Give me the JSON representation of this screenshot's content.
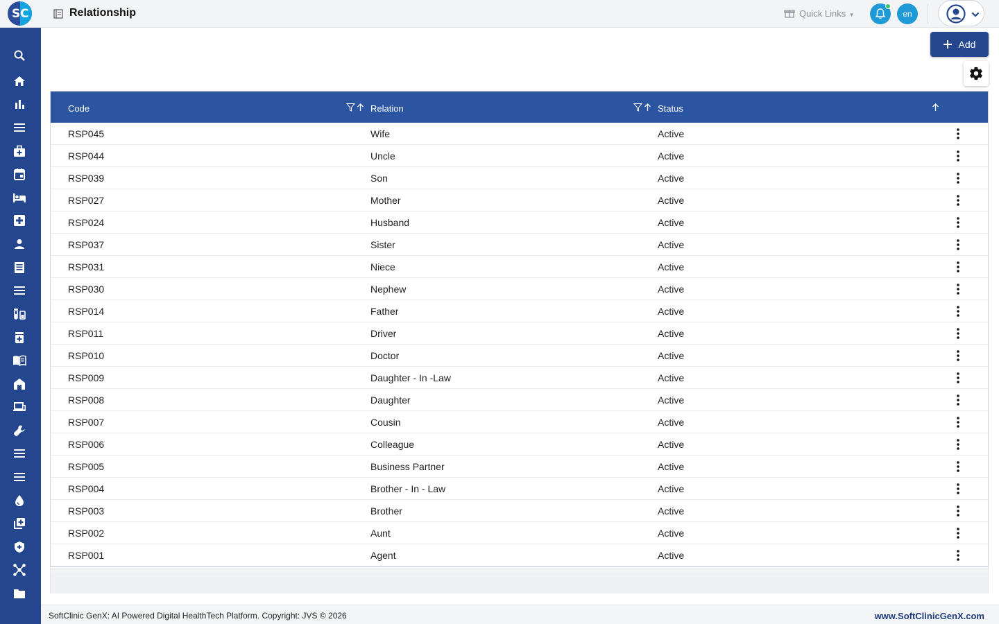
{
  "header": {
    "logo": "SC",
    "page_title": "Relationship",
    "quick_links_label": "Quick Links",
    "language": "en"
  },
  "sidebar": {
    "items": [
      {
        "icon": "search-icon"
      },
      {
        "icon": "home-icon"
      },
      {
        "icon": "bar-chart-icon"
      },
      {
        "icon": "menu-icon"
      },
      {
        "icon": "medical-bag-icon"
      },
      {
        "icon": "calendar-icon"
      },
      {
        "icon": "bed-icon"
      },
      {
        "icon": "medical-cross-icon"
      },
      {
        "icon": "person-icon"
      },
      {
        "icon": "document-icon"
      },
      {
        "icon": "list-icon"
      },
      {
        "icon": "lab-icon"
      },
      {
        "icon": "medicine-icon"
      },
      {
        "icon": "book-icon"
      },
      {
        "icon": "building-icon"
      },
      {
        "icon": "devices-icon"
      },
      {
        "icon": "wrench-icon"
      },
      {
        "icon": "list-icon"
      },
      {
        "icon": "list-icon"
      },
      {
        "icon": "blood-drop-icon"
      },
      {
        "icon": "add-box-icon"
      },
      {
        "icon": "shield-icon"
      },
      {
        "icon": "network-icon"
      },
      {
        "icon": "folder-icon"
      }
    ]
  },
  "toolbar": {
    "add_label": "Add"
  },
  "table": {
    "columns": [
      "Code",
      "Relation",
      "Status"
    ],
    "rows": [
      {
        "code": "RSP045",
        "relation": "Wife",
        "status": "Active"
      },
      {
        "code": "RSP044",
        "relation": "Uncle",
        "status": "Active"
      },
      {
        "code": "RSP039",
        "relation": "Son",
        "status": "Active"
      },
      {
        "code": "RSP027",
        "relation": "Mother",
        "status": "Active"
      },
      {
        "code": "RSP024",
        "relation": "Husband",
        "status": "Active"
      },
      {
        "code": "RSP037",
        "relation": "Sister",
        "status": "Active"
      },
      {
        "code": "RSP031",
        "relation": "Niece",
        "status": "Active"
      },
      {
        "code": "RSP030",
        "relation": "Nephew",
        "status": "Active"
      },
      {
        "code": "RSP014",
        "relation": "Father",
        "status": "Active"
      },
      {
        "code": "RSP011",
        "relation": "Driver",
        "status": "Active"
      },
      {
        "code": "RSP010",
        "relation": "Doctor",
        "status": "Active"
      },
      {
        "code": "RSP009",
        "relation": "Daughter - In -Law",
        "status": "Active"
      },
      {
        "code": "RSP008",
        "relation": "Daughter",
        "status": "Active"
      },
      {
        "code": "RSP007",
        "relation": "Cousin",
        "status": "Active"
      },
      {
        "code": "RSP006",
        "relation": "Colleague",
        "status": "Active"
      },
      {
        "code": "RSP005",
        "relation": "Business Partner",
        "status": "Active"
      },
      {
        "code": "RSP004",
        "relation": "Brother - In - Law",
        "status": "Active"
      },
      {
        "code": "RSP003",
        "relation": "Brother",
        "status": "Active"
      },
      {
        "code": "RSP002",
        "relation": "Aunt",
        "status": "Active"
      },
      {
        "code": "RSP001",
        "relation": "Agent",
        "status": "Active"
      }
    ]
  },
  "footer": {
    "copyright": "SoftClinic GenX: AI Powered Digital HealthTech Platform. Copyright: JVS © 2026",
    "website": "www.SoftClinicGenX.com"
  },
  "colors": {
    "primary": "#24468f",
    "table_header": "#2b55a1",
    "accent_blue": "#1f9ad6"
  }
}
